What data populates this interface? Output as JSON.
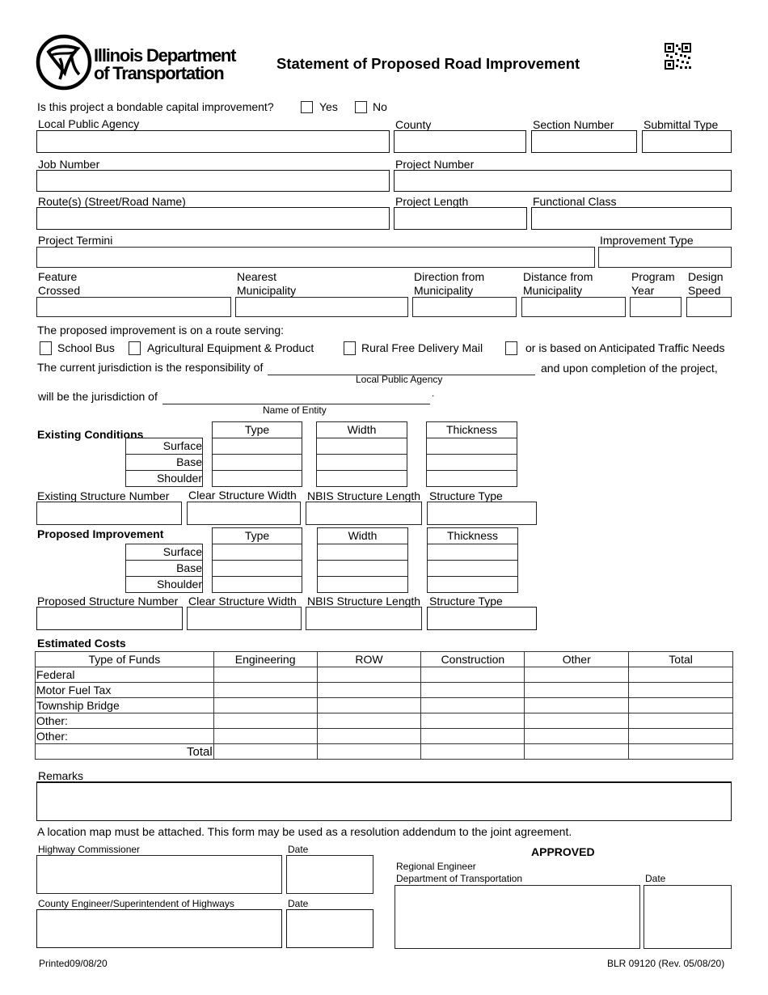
{
  "header": {
    "logo_line1": "Illinois Department",
    "logo_line2": "of Transportation",
    "title": "Statement of Proposed Road Improvement",
    "logo_icon": "idot-triquetra-logo",
    "qr_icon": "qr-code"
  },
  "bondable": {
    "question": "Is this project a bondable capital improvement?",
    "yes_label": "Yes",
    "no_label": "No",
    "yes_checked": false,
    "no_checked": false
  },
  "fields": {
    "local_public_agency": {
      "label": "Local Public Agency",
      "value": ""
    },
    "county": {
      "label": "County",
      "value": ""
    },
    "section_number": {
      "label": "Section Number",
      "value": ""
    },
    "submittal_type": {
      "label": "Submittal Type",
      "value": ""
    },
    "job_number": {
      "label": "Job Number",
      "value": ""
    },
    "project_number": {
      "label": "Project Number",
      "value": ""
    },
    "routes": {
      "label": "Route(s) (Street/Road Name)",
      "value": ""
    },
    "project_length": {
      "label": "Project Length",
      "value": ""
    },
    "functional_class": {
      "label": "Functional Class",
      "value": ""
    },
    "project_termini": {
      "label": "Project Termini",
      "value": ""
    },
    "improvement_type": {
      "label": "Improvement Type",
      "value": ""
    },
    "feature_crossed": {
      "label1": "Feature",
      "label2": "Crossed",
      "value": ""
    },
    "nearest_municipality": {
      "label1": "Nearest",
      "label2": "Municipality",
      "value": ""
    },
    "direction_from": {
      "label1": "Direction from",
      "label2": "Municipality",
      "value": ""
    },
    "distance_from": {
      "label1": "Distance from",
      "label2": "Municipality",
      "value": ""
    },
    "program_year": {
      "label1": "Program",
      "label2": "Year",
      "value": ""
    },
    "design_speed": {
      "label1": "Design",
      "label2": "Speed",
      "value": ""
    }
  },
  "route_serving": {
    "intro": "The proposed improvement  is on a route serving:",
    "options": [
      {
        "label": "School Bus",
        "checked": false
      },
      {
        "label": "Agricultural Equipment & Product",
        "checked": false
      },
      {
        "label": "Rural Free Delivery Mail",
        "checked": false
      },
      {
        "label": "or is based on Anticipated Traffic Needs",
        "checked": false
      }
    ]
  },
  "jurisdiction": {
    "line1_prefix": "The current jurisdiction is the responsibility of",
    "line1_suffix": "and upon completion of the project,",
    "line1_caption": "Local Public Agency",
    "line2_prefix": "will be the jurisdiction of",
    "line2_caption": "Name of Entity",
    "period": "."
  },
  "existing": {
    "title": "Existing Conditions",
    "columns": [
      "Type",
      "Width",
      "Thickness"
    ],
    "rows": [
      "Surface",
      "Base",
      "Shoulder"
    ],
    "structure_labels": [
      "Existing Structure Number",
      "Clear Structure Width",
      "NBIS Structure Length",
      "Structure Type"
    ]
  },
  "proposed": {
    "title": "Proposed Improvement",
    "columns": [
      "Type",
      "Width",
      "Thickness"
    ],
    "rows": [
      "Surface",
      "Base",
      "Shoulder"
    ],
    "structure_labels": [
      "Proposed Structure Number",
      "Clear Structure Width",
      "NBIS Structure Length",
      "Structure Type"
    ]
  },
  "costs": {
    "title": "Estimated Costs",
    "headers": [
      "Type of Funds",
      "Engineering",
      "ROW",
      "Construction",
      "Other",
      "Total"
    ],
    "rows": [
      {
        "label": "Federal",
        "values": [
          "",
          "",
          "",
          "",
          ""
        ]
      },
      {
        "label": "Motor Fuel Tax",
        "values": [
          "",
          "",
          "",
          "",
          ""
        ]
      },
      {
        "label": "Township Bridge",
        "values": [
          "",
          "",
          "",
          "",
          ""
        ]
      },
      {
        "label": "Other:",
        "values": [
          "",
          "",
          "",
          "",
          ""
        ]
      },
      {
        "label": "Other:",
        "values": [
          "",
          "",
          "",
          "",
          ""
        ]
      }
    ],
    "total_label": "Total"
  },
  "remarks": {
    "label": "Remarks",
    "value": ""
  },
  "notice": "A location map must be attached.  This form may be used as a resolution addendum to the joint agreement.",
  "signatures": {
    "highway_commissioner": "Highway Commissioner",
    "county_engineer": "County Engineer/Superintendent of Highways",
    "date": "Date",
    "approved": "APPROVED",
    "regional_engineer_line1": "Regional Engineer",
    "regional_engineer_line2": "Department of Transportation"
  },
  "footer": {
    "printed": "Printed09/08/20",
    "form_id": "BLR 09120 (Rev. 05/08/20)"
  }
}
